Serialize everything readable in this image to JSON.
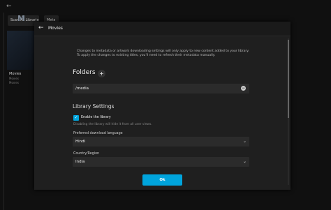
{
  "background": {
    "back_glyph": "←",
    "scan_label": "Scan All Libraries",
    "meta_label": "Meta",
    "card_logo": "M",
    "card_title": "Movies",
    "card_sub1": "Movies",
    "card_sub2": "Movies"
  },
  "dialog": {
    "title": "Movies",
    "notice_line1": "Changes to metadata or artwork downloading settings will only apply to new content added to your library.",
    "notice_line2": "To apply the changes to existing titles, you'll need to refresh their metadata manually.",
    "folders_heading": "Folders",
    "folders": [
      "/media"
    ],
    "library_settings_heading": "Library Settings",
    "enable_library_label": "Enable the library",
    "enable_library_checked": true,
    "enable_library_help": "Disabling the library will hide it from all user views.",
    "download_language_label": "Preferred download language",
    "download_language_value": "Hindi",
    "country_label": "Country/Region",
    "country_value": "India",
    "ok_label": "Ok"
  },
  "colors": {
    "accent": "#00a4dc",
    "dialog_bg": "#1f1f1f",
    "field_bg": "#2b2b2b"
  },
  "icons": {
    "back": "arrow-left-icon",
    "add": "plus-icon",
    "remove": "minus-circle-icon",
    "dropdown": "chevron-down-icon",
    "check": "check-icon"
  }
}
